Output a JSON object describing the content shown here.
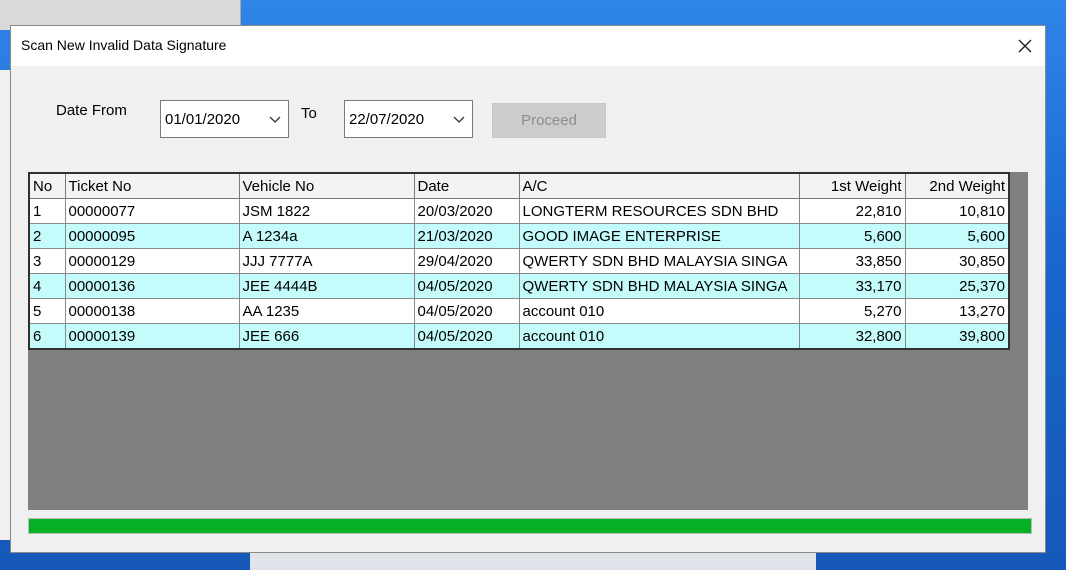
{
  "dialog": {
    "title": "Scan New Invalid Data Signature",
    "close_icon": "close-icon"
  },
  "filters": {
    "date_from_label": "Date From",
    "date_from_value": "01/01/2020",
    "to_label": "To",
    "date_to_value": "22/07/2020",
    "proceed_label": "Proceed"
  },
  "table": {
    "columns": [
      "No",
      "Ticket No",
      "Vehicle No",
      "Date",
      "A/C",
      "1st Weight",
      "2nd Weight"
    ],
    "rows": [
      [
        "1",
        "00000077",
        "JSM 1822",
        "20/03/2020",
        "LONGTERM RESOURCES SDN BHD",
        "22,810",
        "10,810"
      ],
      [
        "2",
        "00000095",
        "A 1234a",
        "21/03/2020",
        "GOOD IMAGE ENTERPRISE",
        "5,600",
        "5,600"
      ],
      [
        "3",
        "00000129",
        "JJJ 7777A",
        "29/04/2020",
        "QWERTY SDN BHD MALAYSIA SINGA",
        "33,850",
        "30,850"
      ],
      [
        "4",
        "00000136",
        "JEE 4444B",
        "04/05/2020",
        "QWERTY SDN BHD MALAYSIA SINGA",
        "33,170",
        "25,370"
      ],
      [
        "5",
        "00000138",
        "AA 1235",
        "04/05/2020",
        "account 010",
        "5,270",
        "13,270"
      ],
      [
        "6",
        "00000139",
        "JEE 666",
        "04/05/2020",
        "account 010",
        "32,800",
        "39,800"
      ]
    ]
  },
  "progress": {
    "value": 1.0,
    "color": "#06b025"
  },
  "colors": {
    "row_alt": "#c4fbfb",
    "grid_bg": "#808080"
  }
}
